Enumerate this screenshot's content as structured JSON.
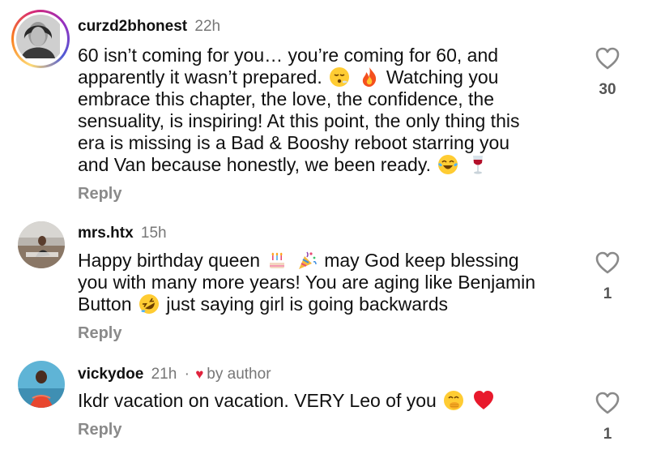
{
  "comments": [
    {
      "username": "curzd2bhonest",
      "time": "22h",
      "lines": [
        [
          "60 isn’t coming for you… you’re coming for 60, and"
        ],
        [
          "apparently it wasn’t prepared. ",
          " ",
          " Watching you"
        ],
        [
          "embrace this chapter, the love, the confidence, the"
        ],
        [
          "sensuality, is inspiring! At this point, the only thing this"
        ],
        [
          "era is missing is a Bad & Booshy reboot starring you"
        ],
        [
          "and Van because honestly, we been ready. ",
          " "
        ]
      ],
      "emojis": [
        "face-exhaling-emoji",
        "fire-emoji",
        "tears-of-joy-emoji",
        "wine-glass-emoji"
      ],
      "reply": "Reply",
      "likes": "30"
    },
    {
      "username": "mrs.htx",
      "time": "15h",
      "lines": [
        [
          "Happy birthday queen ",
          " ",
          " may God keep blessing"
        ],
        [
          "you with many more years! You are aging like Benjamin"
        ],
        [
          "Button ",
          " just saying girl is going backwards"
        ]
      ],
      "emojis": [
        "birthday-cake-emoji",
        "party-popper-emoji",
        "rolling-laughing-emoji"
      ],
      "reply": "Reply",
      "likes": "1"
    },
    {
      "username": "vickydoe",
      "time": "21h",
      "separator": "·",
      "author_badge": "by author",
      "lines": [
        [
          "Ikdr vacation on vacation. VERY Leo of you ",
          " "
        ]
      ],
      "emojis": [
        "face-hand-over-mouth-emoji",
        "red-heart-emoji"
      ],
      "reply": "Reply",
      "likes": "1"
    }
  ],
  "colors": {
    "text": "#101010",
    "muted": "#777777",
    "author_heart": "#e0233d",
    "story_ring": [
      "#feda75",
      "#fa7e1e",
      "#d62976",
      "#962fbf",
      "#4f5bd5"
    ]
  }
}
